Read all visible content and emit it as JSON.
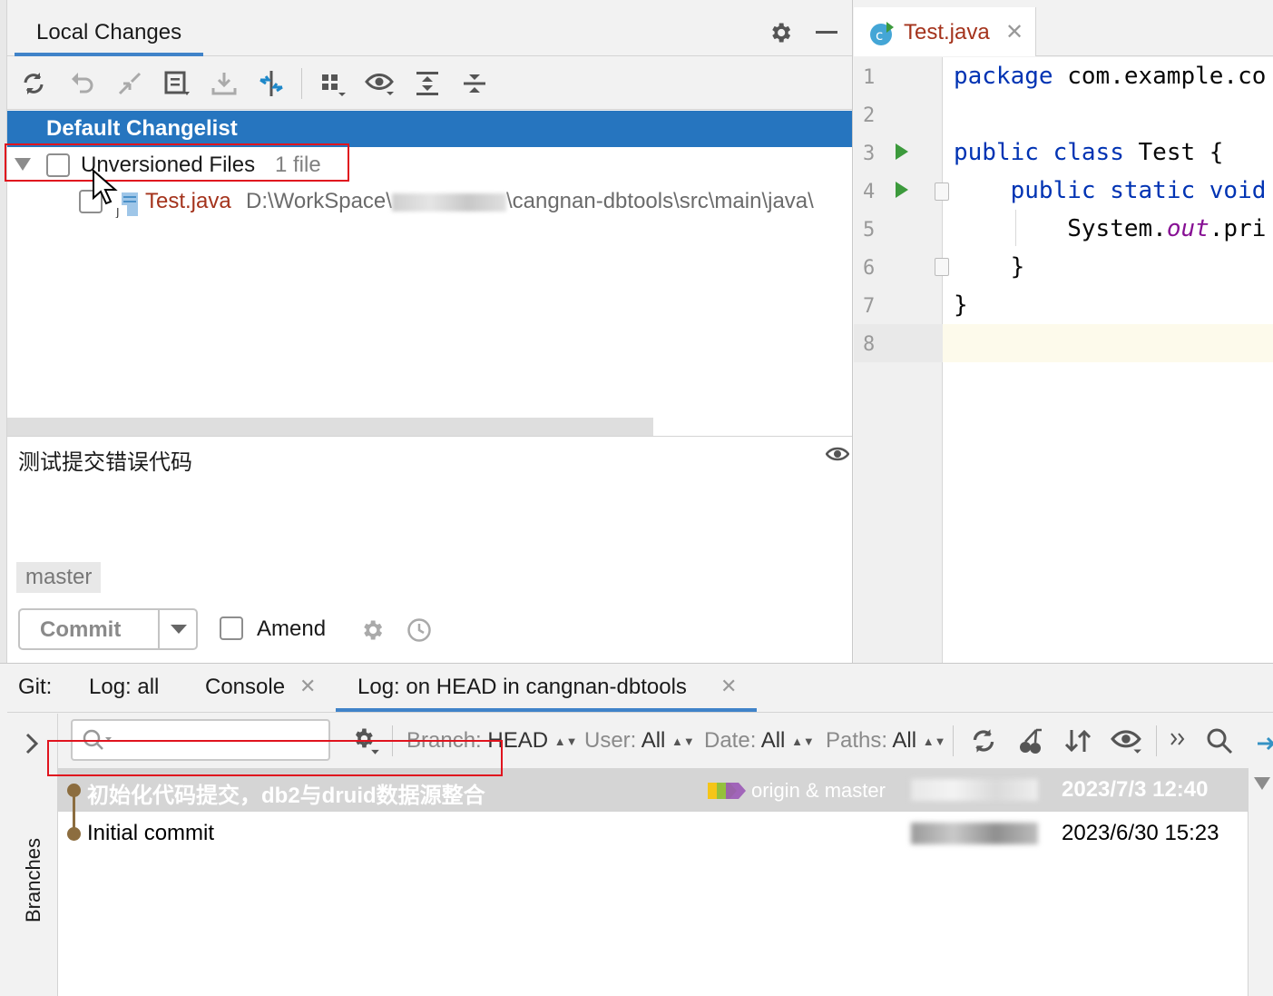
{
  "local_changes": {
    "tab_label": "Local Changes",
    "toolbar_icons": [
      "refresh-icon",
      "rollback-icon",
      "diff-icon",
      "shelve-icon",
      "update-icon",
      "group-by-icon",
      "layout-icon",
      "eye-icon",
      "expand-all-icon",
      "collapse-all-icon"
    ],
    "changelist": "Default Changelist",
    "unversioned": {
      "label": "Unversioned Files",
      "count": "1 file"
    },
    "file": {
      "name": "Test.java",
      "path_prefix": "D:\\WorkSpace\\",
      "path_suffix": "\\cangnan-dbtools\\src\\main\\java\\"
    },
    "commit_message": "测试提交错误代码",
    "branch": "master",
    "commit_button": "Commit",
    "amend_label": "Amend"
  },
  "editor": {
    "tab_title": "Test.java",
    "line_numbers": [
      "1",
      "2",
      "3",
      "4",
      "5",
      "6",
      "7",
      "8"
    ],
    "code": {
      "l1_kw": "package",
      "l1_rest": " com.example.co",
      "l3_kw1": "public",
      "l3_kw2": "class",
      "l3_rest": " Test {",
      "l4_kw1": "public",
      "l4_kw2": "static",
      "l4_kw3": "void",
      "l5_a": "System.",
      "l5_b": "out",
      "l5_c": ".pri",
      "l6": "}",
      "l7": "}"
    }
  },
  "git": {
    "label": "Git:",
    "tabs": [
      "Log: all",
      "Console",
      "Log: on HEAD in cangnan-dbtools"
    ],
    "branches_label": "Branches",
    "filters": {
      "branch_label": "Branch:",
      "branch_value": "HEAD",
      "user_label": "User:",
      "user_value": "All",
      "date_label": "Date:",
      "date_value": "All",
      "paths_label": "Paths:",
      "paths_value": "All"
    },
    "commits": [
      {
        "message": "初始化代码提交，db2与druid数据源整合",
        "refs": "origin & master",
        "date": "2023/7/3 12:40"
      },
      {
        "message": "Initial commit",
        "refs": "",
        "date": "2023/6/30 15:23"
      }
    ]
  },
  "colors": {
    "accent": "#2675bf",
    "highlight_red": "#e0141e",
    "file_red": "#a4331c",
    "keyword_blue": "#0033b3"
  }
}
